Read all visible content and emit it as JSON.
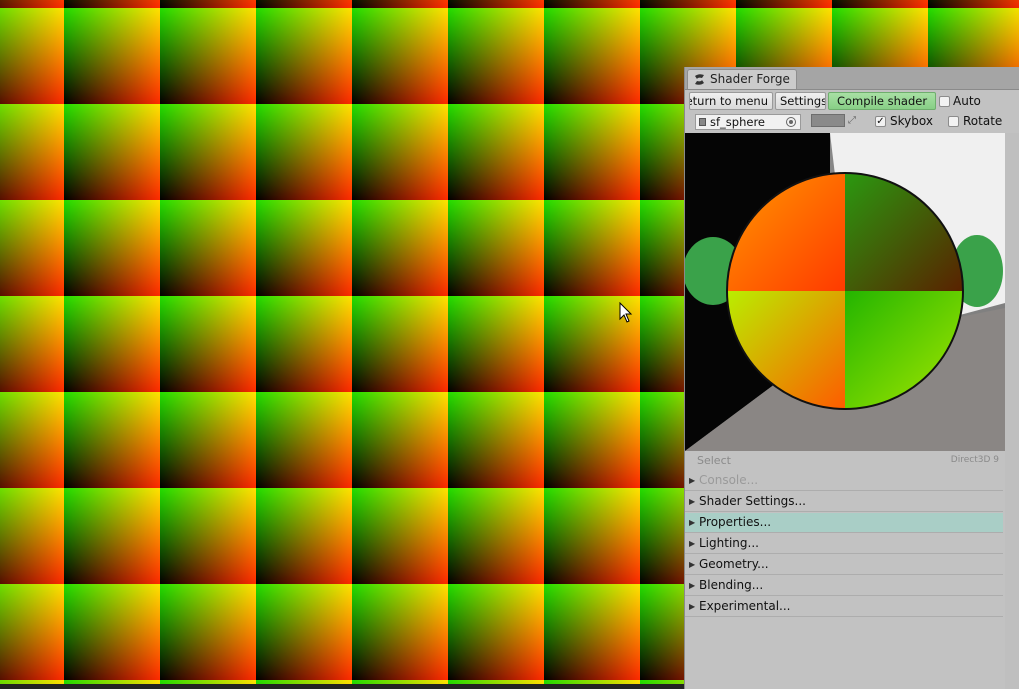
{
  "window": {
    "tab_title": "Shader Forge"
  },
  "toolbar": {
    "return_label": "Return to menu",
    "settings_label": "Settings",
    "compile_label": "Compile shader",
    "auto_label": "Auto",
    "auto_checked": false
  },
  "preview_options": {
    "mesh_name": "sf_sphere",
    "background_color": "#8a8a8a",
    "skybox_label": "Skybox",
    "skybox_checked": true,
    "rotate_label": "Rotate",
    "rotate_checked": false
  },
  "status": {
    "select_label": "Select",
    "info_text": "Direct3D 9"
  },
  "sections": [
    {
      "label": "Console...",
      "state": "disabled"
    },
    {
      "label": "Shader Settings...",
      "state": "normal"
    },
    {
      "label": "Properties...",
      "state": "highlight"
    },
    {
      "label": "Lighting...",
      "state": "normal"
    },
    {
      "label": "Geometry...",
      "state": "normal"
    },
    {
      "label": "Blending...",
      "state": "normal"
    },
    {
      "label": "Experimental...",
      "state": "normal"
    }
  ],
  "colors": {
    "compile_button": "#95d592",
    "highlight_row": "#a9cec6",
    "pattern_green": "#1ecb00",
    "pattern_red": "#ff3000",
    "pattern_yellow": "#ffe400"
  }
}
